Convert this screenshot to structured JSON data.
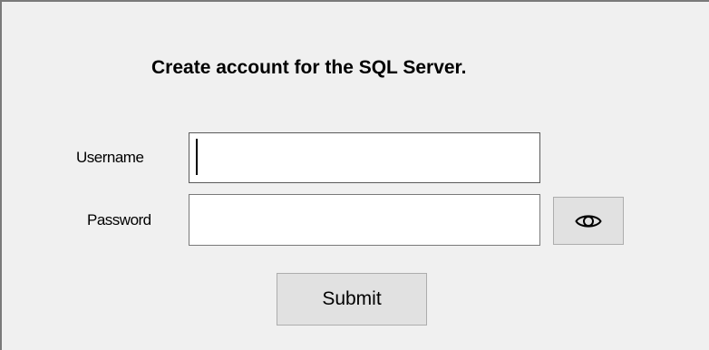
{
  "form": {
    "title": "Create account for the SQL Server.",
    "username_label": "Username",
    "username_value": "",
    "password_label": "Password",
    "password_value": "",
    "submit_label": "Submit",
    "toggle_password_icon": "eye-icon"
  },
  "colors": {
    "window_background": "#f0f0f0",
    "button_background": "#e1e1e1",
    "input_background": "#ffffff",
    "border": "#7a7a7a"
  }
}
